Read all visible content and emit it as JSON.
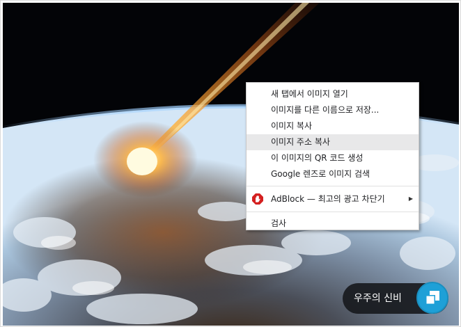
{
  "context_menu": {
    "items": [
      {
        "label": "새 탭에서 이미지 열기"
      },
      {
        "label": "이미지를 다른 이름으로 저장..."
      },
      {
        "label": "이미지 복사"
      },
      {
        "label": "이미지 주소 복사",
        "highlighted": true
      },
      {
        "label": "이 이미지의 QR 코드 생성"
      },
      {
        "label": "Google 렌즈로 이미지 검색"
      }
    ],
    "extension": {
      "label": "AdBlock — 최고의 광고 차단기",
      "icon": "adblock-hand-icon"
    },
    "inspect": {
      "label": "검사"
    }
  },
  "caption": {
    "label": "우주의 신비",
    "button_icon": "copy-icon"
  },
  "colors": {
    "menu_highlight": "#e8e8e9",
    "copy_button": "#1ea0d7",
    "adblock_red": "#d42020"
  }
}
